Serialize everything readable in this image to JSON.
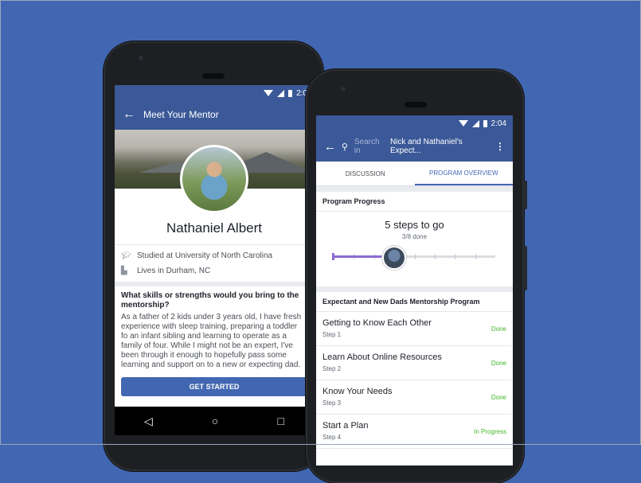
{
  "left_phone": {
    "status_time": "2:0",
    "header_title": "Meet Your Mentor",
    "name": "Nathaniel Albert",
    "education": "Studied at University of North Carolina",
    "location": "Lives in Durham, NC",
    "question": "What skills or strengths would you bring to the mentorship?",
    "answer": "As a father of 2 kids under 3 years old, I have fresh experience with sleep training, preparing a toddler fo an infant sibling and learning to operate as a family of four. While I might not be an expert, I've been through it enough to hopefully pass some learning and support on to a new or expecting dad.",
    "cta_label": "GET STARTED",
    "nav_back": "◁",
    "nav_home": "○",
    "nav_recent": "□"
  },
  "right_phone": {
    "status_time": "2:04",
    "search_placeholder": "Search in",
    "search_group": "Nick and Nathaniel's Expect...",
    "tabs": [
      "DISCUSSION",
      "PROGRAM OVERVIEW"
    ],
    "progress_title": "Program Progress",
    "steps_to_go": "5 steps to go",
    "done_count": "3/8 done",
    "progress_fraction": 0.375,
    "program_title": "Expectant and New Dads Mentorship Program",
    "steps": [
      {
        "title": "Getting to Know Each Other",
        "step": "Step 1",
        "status": "Done"
      },
      {
        "title": "Learn About Online Resources",
        "step": "Step 2",
        "status": "Done"
      },
      {
        "title": "Know Your Needs",
        "step": "Step 3",
        "status": "Done"
      },
      {
        "title": "Start a Plan",
        "step": "Step 4",
        "status": "In Progress"
      }
    ]
  },
  "colors": {
    "background": "#4267b2",
    "header": "#3b5998",
    "accent": "#4267b2",
    "done": "#42b72a",
    "progress": "#8b6ad1"
  }
}
